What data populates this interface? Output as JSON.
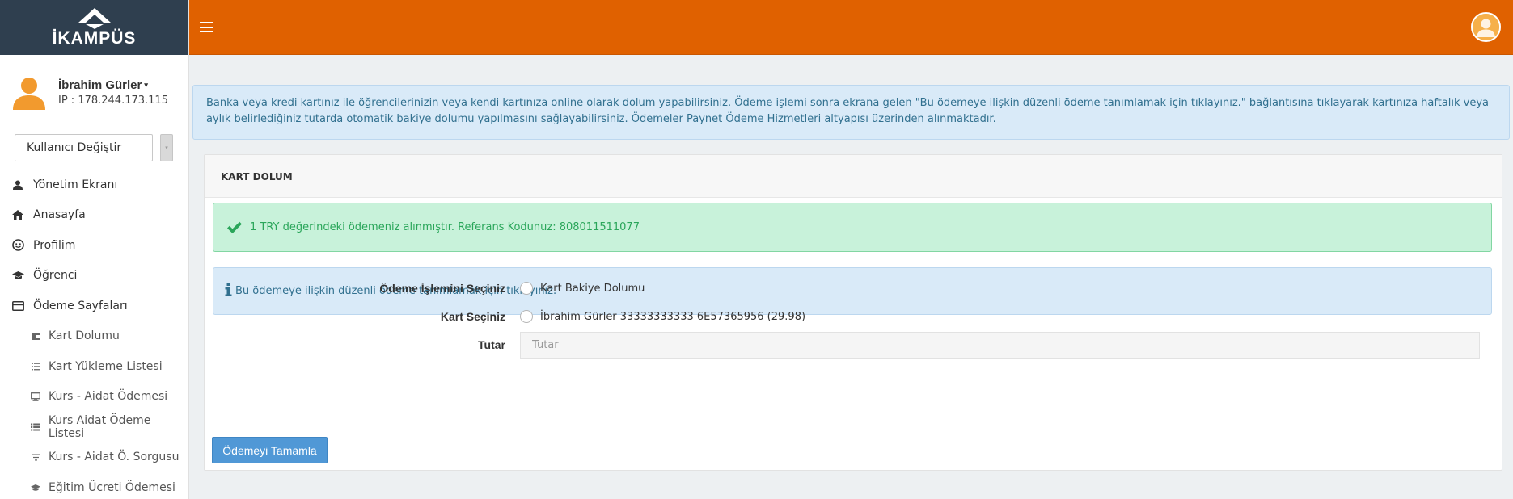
{
  "brand": {
    "logo_text": "İKAMPÜS"
  },
  "header": {
    "hamburger_icon": "hamburger-icon",
    "avatar_icon": "user-avatar-icon",
    "accent_color": "#e06100"
  },
  "user": {
    "name": "İbrahim Gürler",
    "ip": "IP : 178.244.173.115",
    "dropdown_caret": "▾"
  },
  "user_switch": {
    "selected": "Kullanıcı Değiştir",
    "arrow": "▾"
  },
  "sidebar": {
    "items": [
      {
        "label": "Yönetim Ekranı",
        "icon": "person-icon",
        "level": "top"
      },
      {
        "label": "Anasayfa",
        "icon": "home-icon",
        "level": "top"
      },
      {
        "label": "Profilim",
        "icon": "smile-icon",
        "level": "top"
      },
      {
        "label": "Öğrenci",
        "icon": "graduation-cap-icon",
        "level": "top"
      },
      {
        "label": "Ödeme Sayfaları",
        "icon": "credit-card-icon",
        "level": "top"
      },
      {
        "label": "Kart Dolumu",
        "icon": "wallet-icon",
        "level": "sub"
      },
      {
        "label": "Kart Yükleme Listesi",
        "icon": "list-icon",
        "level": "sub"
      },
      {
        "label": "Kurs - Aidat Ödemesi",
        "icon": "monitor-icon",
        "level": "sub"
      },
      {
        "label": "Kurs Aidat Ödeme Listesi",
        "icon": "bullet-list-icon",
        "level": "sub"
      },
      {
        "label": "Kurs - Aidat Ö. Sorgusu",
        "icon": "filter-icon",
        "level": "sub"
      },
      {
        "label": "Eğitim Ücreti Ödemesi",
        "icon": "graduation-cap-icon",
        "level": "sub"
      }
    ]
  },
  "info_banner": {
    "text": "Banka veya kredi kartınız ile öğrencilerinizin veya kendi kartınıza online olarak dolum yapabilirsiniz. Ödeme işlemi sonra ekrana gelen \"Bu ödemeye ilişkin düzenli ödeme tanımlamak için tıklayınız.\" bağlantısına tıklayarak kartınıza haftalık veya aylık belirlediğiniz tutarda otomatik bakiye dolumu yapılmasını sağlayabilirsiniz. Ödemeler Paynet Ödeme Hizmetleri altyapısı üzerinden alınmaktadır."
  },
  "panel": {
    "title": "KART DOLUM",
    "success_message": "1 TRY değerindeki ödemeniz alınmıştır. Referans Kodunuz: 808011511077",
    "recurring_link": "Bu ödemeye ilişkin düzenli ödeme tanımlamak için tıklayınız.",
    "form": {
      "operation_label": "Ödeme İşlemini Seçiniz",
      "operation_option": "Kart Bakiye Dolumu",
      "card_label": "Kart Seçiniz",
      "card_option": "İbrahim Gürler 33333333333 6E57365956 (29.98)",
      "amount_label": "Tutar",
      "amount_placeholder": "Tutar",
      "amount_value": ""
    },
    "submit_label": "Ödemeyi Tamamla"
  },
  "colors": {
    "success_text": "#2aa65a",
    "info_text": "#31708f",
    "button": "#5098d6"
  }
}
